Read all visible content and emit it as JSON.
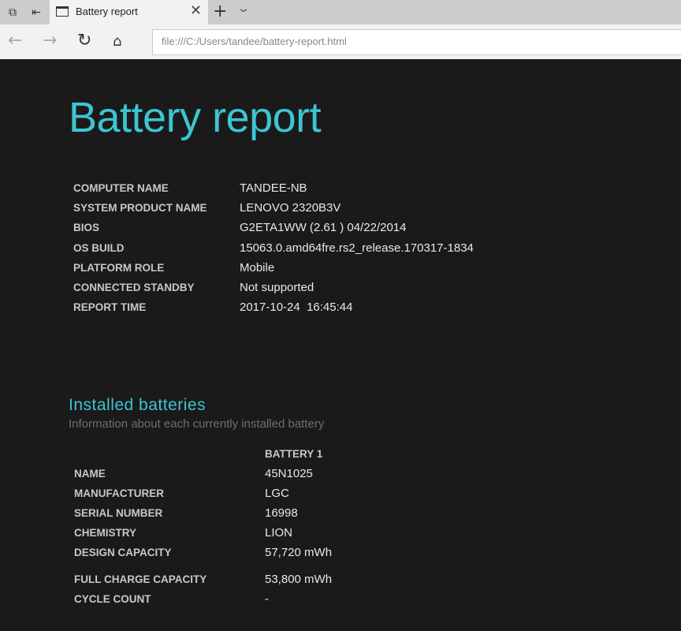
{
  "browser": {
    "tab_title": "Battery report",
    "url": "file:///C:/Users/tandee/battery-report.html"
  },
  "report": {
    "title": "Battery report",
    "info": [
      {
        "label": "COMPUTER NAME",
        "value": "TANDEE-NB"
      },
      {
        "label": "SYSTEM PRODUCT NAME",
        "value": "LENOVO 2320B3V"
      },
      {
        "label": "BIOS",
        "value": "G2ETA1WW (2.61 ) 04/22/2014"
      },
      {
        "label": "OS BUILD",
        "value": "15063.0.amd64fre.rs2_release.170317-1834"
      },
      {
        "label": "PLATFORM ROLE",
        "value": "Mobile"
      },
      {
        "label": "CONNECTED STANDBY",
        "value": "Not supported"
      },
      {
        "label": "REPORT TIME",
        "value": "2017-10-24  16:45:44"
      }
    ]
  },
  "batteries": {
    "heading": "Installed batteries",
    "subtitle": "Information about each currently installed battery",
    "column": "BATTERY 1",
    "rows": [
      {
        "label": "NAME",
        "value": "45N1025"
      },
      {
        "label": "MANUFACTURER",
        "value": "LGC"
      },
      {
        "label": "SERIAL NUMBER",
        "value": "16998"
      },
      {
        "label": "CHEMISTRY",
        "value": "LION"
      },
      {
        "label": "DESIGN CAPACITY",
        "value": "57,720 mWh"
      },
      {
        "label": "FULL CHARGE CAPACITY",
        "value": "53,800 mWh"
      },
      {
        "label": "CYCLE COUNT",
        "value": "-"
      }
    ]
  }
}
